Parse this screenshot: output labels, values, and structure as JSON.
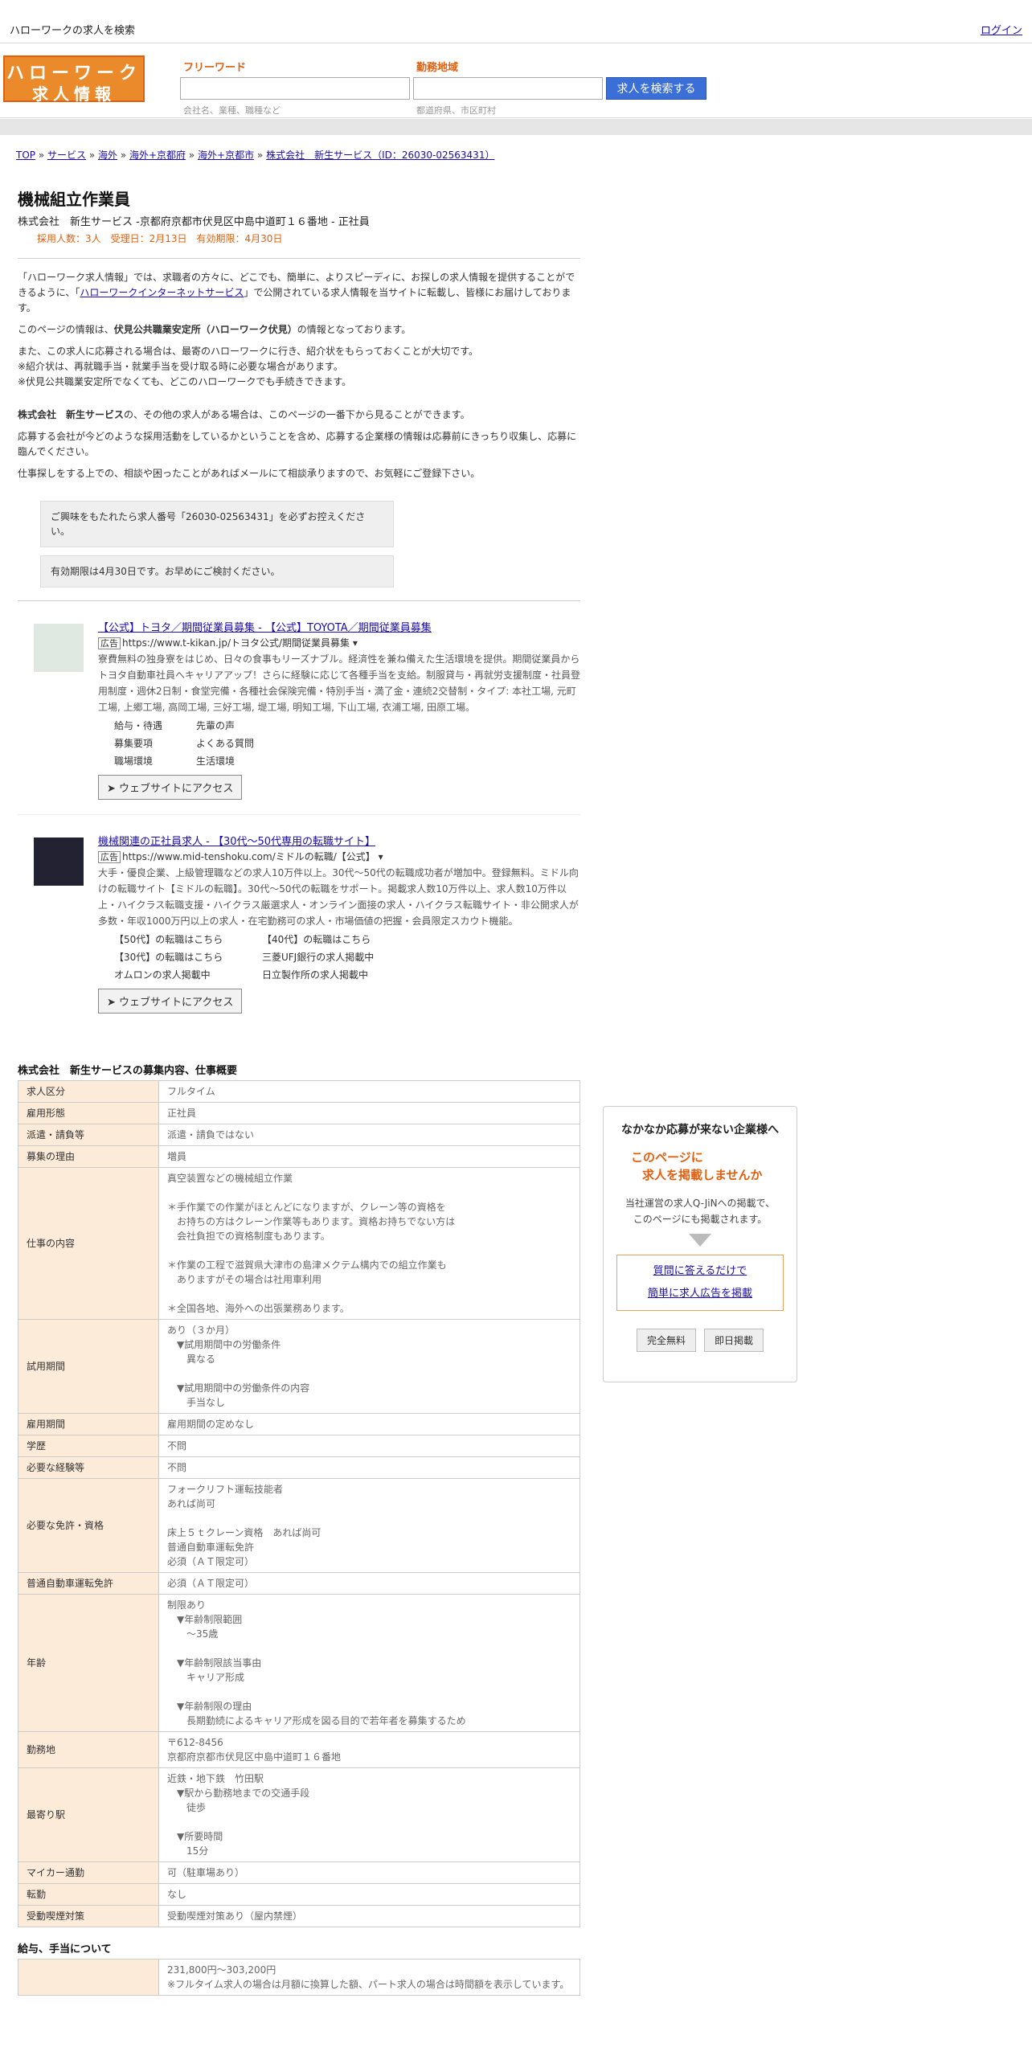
{
  "topbar": {
    "title": "ハローワークの求人を検索",
    "login": "ログイン"
  },
  "logo": {
    "row1": "ハローワーク",
    "row2": "求人情報"
  },
  "search": {
    "freeword_label": "フリーワード",
    "freeword_hint": "会社名、業種、職種など",
    "area_label": "勤務地域",
    "area_hint": "都道府県、市区町村",
    "button": "求人を検索する"
  },
  "breadcrumb": [
    {
      "label": "TOP"
    },
    {
      "label": "サービス"
    },
    {
      "label": "海外"
    },
    {
      "label": "海外+京都府"
    },
    {
      "label": "海外+京都市"
    },
    {
      "label": "株式会社　新生サービス（ID：26030-02563431）"
    }
  ],
  "job": {
    "title": "機械組立作業員",
    "subtitle": "株式会社　新生サービス -京都府京都市伏見区中島中道町１６番地 - 正社員",
    "meta": "採用人数：3人　受理日：2月13日　有効期限：4月30日"
  },
  "intro": {
    "p1a": "「ハローワーク求人情報」では、求職者の方々に、どこでも、簡単に、よりスピーディに、お探しの求人情報を提供することができるように、「",
    "p1link": "ハローワークインターネットサービス",
    "p1b": "」で公開されている求人情報を当サイトに転載し、皆様にお届けしております。",
    "p2a": "このページの情報は、",
    "p2b": "伏見公共職業安定所（ハローワーク伏見）",
    "p2c": "の情報となっております。",
    "p3": "また、この求人に応募される場合は、最寄のハローワークに行き、紹介状をもらっておくことが大切です。",
    "p4": "※紹介状は、再就職手当・就業手当を受け取る時に必要な場合があります。",
    "p5": "※伏見公共職業安定所でなくても、どこのハローワークでも手続きできます。",
    "p6a": "株式会社　新生サービス",
    "p6b": "の、その他の求人がある場合は、このページの一番下から見ることができます。",
    "p7": "応募する会社が今どのような採用活動をしているかということを含め、応募する企業様の情報は応募前にきっちり収集し、応募に臨んでください。",
    "p8": "仕事探しをする上での、相談や困ったことがあればメールにて相談承りますので、お気軽にご登録下さい。",
    "note1": "ご興味をもたれたら求人番号「26030-02563431」を必ずお控えください。",
    "note2": "有効期限は4月30日です。お早めにご検討ください。"
  },
  "ads": [
    {
      "title": "【公式】トヨタ／期間従業員募集 - 【公式】TOYOTA／期間従業員募集",
      "badge": "広告",
      "url": "https://www.t-kikan.jp/トヨタ公式/期間従業員募集 ▾",
      "desc": "寮費無料の独身寮をはじめ、日々の食事もリーズナブル。経済性を兼ね備えた生活環境を提供。期間従業員からトヨタ自動車社員へキャリアアップ！さらに経験に応じて各種手当を支給。制服貸与・再就労支援制度・社員登用制度・週休2日制・食堂完備・各種社会保険完備・特別手当・満了金・連続2交替制・タイプ: 本社工場, 元町工場, 上郷工場, 高岡工場, 三好工場, 堤工場, 明知工場, 下山工場, 衣浦工場, 田原工場。",
      "links": [
        "給与・待遇",
        "先輩の声",
        "募集要項",
        "よくある質問",
        "職場環境",
        "生活環境"
      ],
      "cta": "➤ ウェブサイトにアクセス"
    },
    {
      "title": "機械関連の正社員求人 - 【30代～50代専用の転職サイト】",
      "badge": "広告",
      "url": "https://www.mid-tenshoku.com/ミドルの転職/【公式】 ▾",
      "desc": "大手・優良企業、上級管理職などの求人10万件以上。30代～50代の転職成功者が増加中。登録無料。ミドル向けの転職サイト【ミドルの転職】。30代～50代の転職をサポート。掲載求人数10万件以上、求人数10万件以上・ハイクラス転職支援・ハイクラス厳選求人・オンライン面接の求人・ハイクラス転職サイト・非公開求人が多数・年収1000万円以上の求人・在宅勤務可の求人・市場価値の把握・会員限定スカウト機能。",
      "links": [
        "【50代】の転職はこちら",
        "【40代】の転職はこちら",
        "【30代】の転職はこちら",
        "三菱UFJ銀行の求人掲載中",
        "オムロンの求人掲載中",
        "日立製作所の求人掲載中"
      ],
      "cta": "➤ ウェブサイトにアクセス"
    }
  ],
  "details_heading": "株式会社　新生サービスの募集内容、仕事概要",
  "details": [
    {
      "k": "求人区分",
      "v": "フルタイム"
    },
    {
      "k": "雇用形態",
      "v": "正社員"
    },
    {
      "k": "派遣・請負等",
      "v": "派遣・請負ではない"
    },
    {
      "k": "募集の理由",
      "v": "増員"
    },
    {
      "k": "仕事の内容",
      "v": "真空装置などの機械組立作業\n\n＊手作業での作業がほとんどになりますが、クレーン等の資格を\n　お持ちの方はクレーン作業等もあります。資格お持ちでない方は\n　会社負担での資格制度もあります。\n\n＊作業の工程で滋賀県大津市の島津メクテム構内での組立作業も\n　ありますがその場合は社用車利用\n\n＊全国各地、海外への出張業務あります。"
    },
    {
      "k": "試用期間",
      "v": "あり（３か月）\n　▼試用期間中の労働条件\n　　異なる\n\n　▼試用期間中の労働条件の内容\n　　手当なし"
    },
    {
      "k": "雇用期間",
      "v": "雇用期間の定めなし"
    },
    {
      "k": "学歴",
      "v": "不問"
    },
    {
      "k": "必要な経験等",
      "v": "不問"
    },
    {
      "k": "必要な免許・資格",
      "v": "フォークリフト運転技能者\nあれば尚可\n\n床上５ｔクレーン資格　あれば尚可\n普通自動車運転免許\n必須（ＡＴ限定可）"
    },
    {
      "k": "普通自動車運転免許",
      "v": "必須（ＡＴ限定可）"
    },
    {
      "k": "年齢",
      "v": "制限あり\n　▼年齢制限範囲\n　　～35歳\n\n　▼年齢制限該当事由\n　　キャリア形成\n\n　▼年齢制限の理由\n　　長期勤続によるキャリア形成を図る目的で若年者を募集するため"
    },
    {
      "k": "勤務地",
      "v": "〒612-8456\n京都府京都市伏見区中島中道町１６番地"
    },
    {
      "k": "最寄り駅",
      "v": "近鉄・地下鉄　竹田駅\n　▼駅から勤務地までの交通手段\n　　徒歩\n\n　▼所要時間\n　　15分"
    },
    {
      "k": "マイカー通勤",
      "v": "可（駐車場あり）"
    },
    {
      "k": "転勤",
      "v": "なし"
    },
    {
      "k": "受動喫煙対策",
      "v": "受動喫煙対策あり（屋内禁煙）"
    }
  ],
  "pay_heading": "給与、手当について",
  "pay": [
    {
      "k": "",
      "v": "231,800円〜303,200円\n※フルタイム求人の場合は月額に換算した額、パート求人の場合は時間額を表示しています。"
    }
  ],
  "sidebar": {
    "heading": "なかなか応募が来ない企業様へ",
    "orange1": "このページに",
    "orange2": "求人を掲載しませんか",
    "desc": "当社運営の求人Q-JiNへの掲載で、\nこのページにも掲載されます。",
    "link1": "質問に答えるだけで",
    "link2": "簡単に求人広告を掲載",
    "btn1": "完全無料",
    "btn2": "即日掲載"
  }
}
